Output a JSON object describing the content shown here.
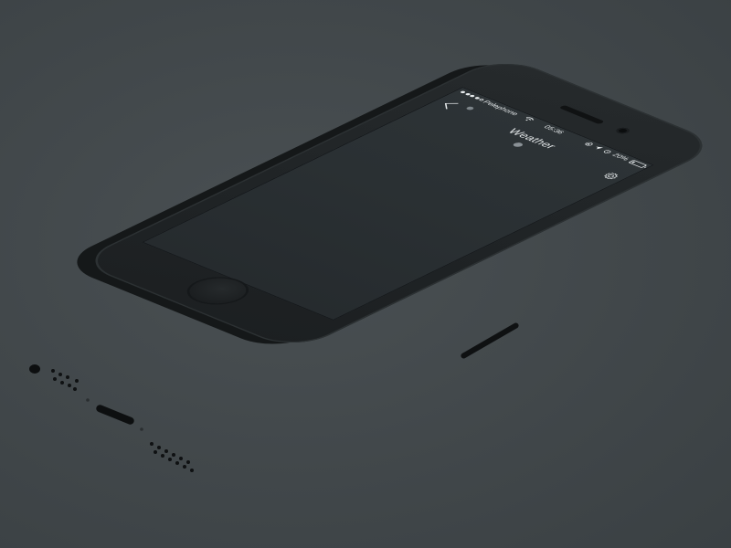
{
  "status_bar": {
    "carrier": "Pelephone",
    "time": "05:36",
    "battery_percent_label": "20%",
    "battery_level": 0.2,
    "signal_bars_filled": 4,
    "signal_bars_total": 5
  },
  "nav_bar": {
    "title": "Weather"
  },
  "icons": {
    "back": "chevron-left-icon",
    "settings": "gear-icon",
    "wifi": "wifi-icon",
    "location": "location-arrow-icon",
    "alarm": "alarm-icon",
    "rotation_lock": "rotation-lock-icon",
    "battery": "battery-icon"
  },
  "colors": {
    "background": "#41474a",
    "phone_body": "#1f2325",
    "screen": "#2a3033",
    "text": "#e8ecee"
  }
}
